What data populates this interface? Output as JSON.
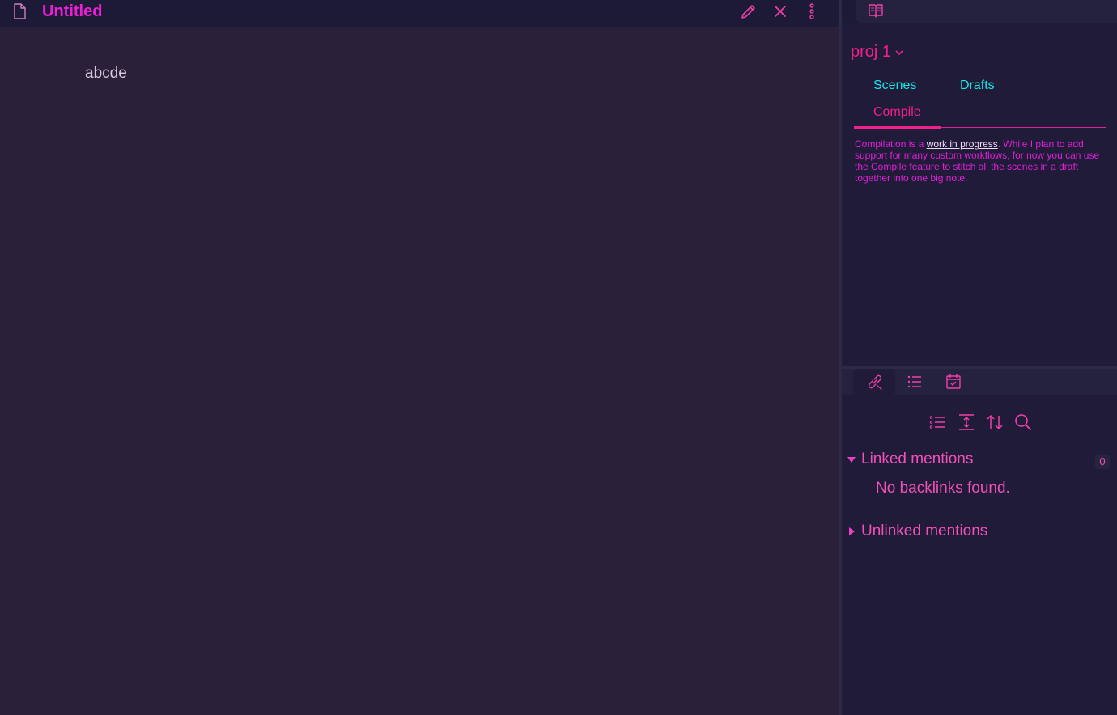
{
  "editor": {
    "title": "Untitled",
    "body_text": "abcde"
  },
  "icons": {
    "file": "file-icon",
    "edit": "pencil-icon",
    "close": "close-icon",
    "more": "more-vertical-icon",
    "book": "book-open-icon",
    "links": "link-icon",
    "outline": "list-icon",
    "calendar": "calendar-check-icon",
    "collapse": "collapse-vertical-icon",
    "sort": "sort-icon",
    "search": "search-icon"
  },
  "sidebar": {
    "project": "proj 1",
    "tabs": {
      "scenes": "Scenes",
      "drafts": "Drafts",
      "compile": "Compile"
    },
    "compile_note": {
      "before": "Compilation is a ",
      "link": "work in progress",
      "after": ". While I plan to add support for many custom workflows, for now you can use the Compile feature to stitch all the scenes in a draft together into one big note."
    }
  },
  "backlinks": {
    "linked_label": "Linked mentions",
    "linked_count": "0",
    "empty_text": "No backlinks found.",
    "unlinked_label": "Unlinked mentions"
  },
  "colors": {
    "accent_magenta": "#ec1ed6",
    "accent_pink": "#f0208c",
    "accent_cyan": "#18e8e8",
    "editor_bg": "#2a203a",
    "sidebar_bg": "#1f1b38"
  }
}
